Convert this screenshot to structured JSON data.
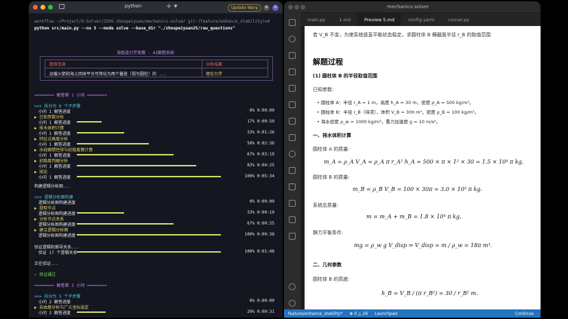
{
  "terminal": {
    "tab_title": "python",
    "update_label": "Update Warp",
    "avatar_initial": "R",
    "prompt_line": "workflow ~/Project/X-Solver/2505-zhoupeiyuan/mechanics-solver git:(feature/enhance_stability)±4",
    "command_line": "python src/main.py --no 5 --mode solve --base_dir \"./zhoupeiyuan25/raw_questions\"",
    "banner": "海姐道力学竞赛 - AI解题系统",
    "table": {
      "header_left": "题目信息",
      "header_right": "分析结果",
      "row_left": "运载火箭和海上回收平台可简化为两个叠放（视为圆柱）的 ...",
      "row_right": "理论力学"
    },
    "section1": "======== 解答第 1 小问 ========",
    "split1": ">>> 拆分为 6 个子步骤",
    "steps1": [
      {
        "label": "小问 1 解答进度",
        "pct": "0%",
        "time": "0:00:00",
        "frac": 0.0,
        "kind": "sub"
      },
      {
        "label": "▶ 已知参数分析",
        "pct": "",
        "time": "",
        "frac": null,
        "kind": "step"
      },
      {
        "label": "小问 1 解答进度",
        "pct": "17%",
        "time": "0:00:50",
        "frac": 0.17,
        "kind": "sub"
      },
      {
        "label": "▶ 排水体积计算",
        "pct": "",
        "time": "",
        "frac": null,
        "kind": "step"
      },
      {
        "label": "小问 1 解答进度",
        "pct": "33%",
        "time": "0:01:26",
        "frac": 0.33,
        "kind": "sub"
      },
      {
        "label": "▶ 特征点高度分析",
        "pct": "",
        "time": "",
        "frac": null,
        "kind": "step"
      },
      {
        "label": "小问 1 解答进度",
        "pct": "50%",
        "time": "0:02:36",
        "frac": 0.5,
        "kind": "sub"
      },
      {
        "label": "▶ 水线面惯性矩与初稳度臂计算",
        "pct": "",
        "time": "",
        "frac": null,
        "kind": "step"
      },
      {
        "label": "小问 1 解答进度",
        "pct": "67%",
        "time": "0:03:19",
        "frac": 0.67,
        "kind": "sub"
      },
      {
        "label": "▶ 初稳度判据分析",
        "pct": "",
        "time": "",
        "frac": null,
        "kind": "step"
      },
      {
        "label": "小问 1 解答进度",
        "pct": "83%",
        "time": "0:04:25",
        "frac": 0.83,
        "kind": "sub"
      },
      {
        "label": "▶ 结论",
        "pct": "",
        "time": "",
        "frac": null,
        "kind": "step"
      },
      {
        "label": "小问 1 解答进度",
        "pct": "100%",
        "time": "0:05:34",
        "frac": 1.0,
        "kind": "sub"
      }
    ],
    "build_graph": "构建逻辑分析图...",
    "split_logic": ">>> 逻辑分析图构建",
    "steps_logic": [
      {
        "label": "逻辑分析图构建进度",
        "pct": "0%",
        "time": "0:00:00",
        "frac": 0.0,
        "kind": "sub"
      },
      {
        "label": "▶ 提取节点",
        "pct": "",
        "time": "",
        "frac": null,
        "kind": "step"
      },
      {
        "label": "逻辑分析图构建进度",
        "pct": "33%",
        "time": "0:00:10",
        "frac": 0.33,
        "kind": "sub"
      },
      {
        "label": "▶ 分析节点关系",
        "pct": "",
        "time": "",
        "frac": null,
        "kind": "step"
      },
      {
        "label": "逻辑分析图构建进度",
        "pct": "67%",
        "time": "0:00:25",
        "frac": 0.67,
        "kind": "sub"
      },
      {
        "label": "▶ 建立逻辑分析图",
        "pct": "",
        "time": "",
        "frac": null,
        "kind": "step"
      },
      {
        "label": "逻辑分析图构建进度",
        "pct": "100%",
        "time": "0:00:38",
        "frac": 1.0,
        "kind": "sub"
      }
    ],
    "verify_line": "验证逻辑和推导关系...",
    "verify_progress": {
      "label": "验证 17 个逻辑关系",
      "pct": "100%",
      "time": "0:01:48",
      "frac": 1.0
    },
    "verifying": "正在验证...",
    "verify_pass": "✓ 验证通过",
    "section2": "======== 解答第 2 小问 ========",
    "split2": ">>> 拆分为 5 个子步骤",
    "steps2": [
      {
        "label": "小问 2 解答进度",
        "pct": "0%",
        "time": "0:00:00",
        "frac": 0.0,
        "kind": "sub"
      },
      {
        "label": "▶ 自由度分析与广义坐标选定",
        "pct": "",
        "time": "",
        "frac": null,
        "kind": "step"
      },
      {
        "label": "小问 2 解答进度",
        "pct": "20%",
        "time": "0:00:31",
        "frac": 0.2,
        "kind": "sub"
      }
    ]
  },
  "editor": {
    "window_title": "mechanics-solver",
    "tabs": [
      "main.py",
      "1.md",
      "Preview 5.md",
      "config.yaml",
      "runner.py"
    ],
    "active_tab": 2,
    "preview": {
      "top_line": "若 V_B 不变，为使系统竖直平衡状态稳定，求圆柱体 B 横截面半径 r_B 的取值范围",
      "h_process": "解题过程",
      "h_part1": "(1) 圆柱体 B 的半径取值范围",
      "known": "已知参数:",
      "li1": "圆柱体 A：半径 r_A = 1 m，高度 h_A = 30 m，密度 ρ_A = 500 kg/m³。",
      "li2": "圆柱体 B：半径 r_B（待求），体积 V_B = 30π m³，密度 ρ_B = 100 kg/m³。",
      "li3": "海水密度 ρ_w = 1000 kg/m³，重力加速度 g = 10 m/s²。",
      "h_one": "一、排水体积计算",
      "mass_a_label": "圆柱体 A 的质量:",
      "mass_a_eq": "m_A = ρ_A V_A = ρ_A π r_A² h_A = 500 × π × 1² × 30 = 1.5 × 10⁴ π kg.",
      "mass_b_label": "圆柱体 B 的质量:",
      "mass_b_eq": "m_B = ρ_B V_B = 100 × 30π = 3.0 × 10³ π kg.",
      "total_label": "系统总质量:",
      "total_eq": "m = m_A + m_B = 1.8 × 10⁴ π kg.",
      "static_label": "静力平衡条件:",
      "static_eq": "mg = ρ_w g V_disp ⇒ V_disp = m / ρ_w = 18π m³.",
      "h_two": "二、几何参数",
      "height_label": "圆柱体 B 的高度:",
      "height_eq": "h_B = V_B / (π r_B²) = 30 / r_B² m."
    },
    "statusbar": {
      "branch": "feature/enhance_stability*",
      "errors": "⊗ 0 △ 26",
      "launchpad": "Launchpad",
      "continue": "Continue"
    }
  },
  "colors": {
    "terminal_bg": "#141720",
    "editor_bg": "#1e1e1e",
    "status_blue": "#2473c0",
    "progress_bar": "#cfe36a"
  }
}
